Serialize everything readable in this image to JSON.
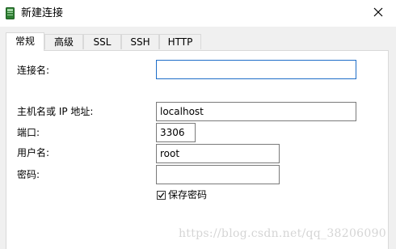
{
  "window": {
    "title": "新建连接",
    "icon": "database-icon",
    "close_icon": "close-icon"
  },
  "tabs": [
    {
      "label": "常规",
      "active": true
    },
    {
      "label": "高级",
      "active": false
    },
    {
      "label": "SSL",
      "active": false
    },
    {
      "label": "SSH",
      "active": false
    },
    {
      "label": "HTTP",
      "active": false
    }
  ],
  "form": {
    "connection_name": {
      "label": "连接名:",
      "value": ""
    },
    "host": {
      "label": "主机名或 IP 地址:",
      "value": "localhost"
    },
    "port": {
      "label": "端口:",
      "value": "3306"
    },
    "username": {
      "label": "用户名:",
      "value": "root"
    },
    "password": {
      "label": "密码:",
      "value": ""
    },
    "save_password": {
      "label": "保存密码",
      "checked": true
    }
  },
  "watermark": "https://blog.csdn.net/qq_38206090",
  "colors": {
    "window_bg": "#f0f0f0",
    "focus_border": "#1e6ec8",
    "icon_green": "#2e7d32"
  }
}
